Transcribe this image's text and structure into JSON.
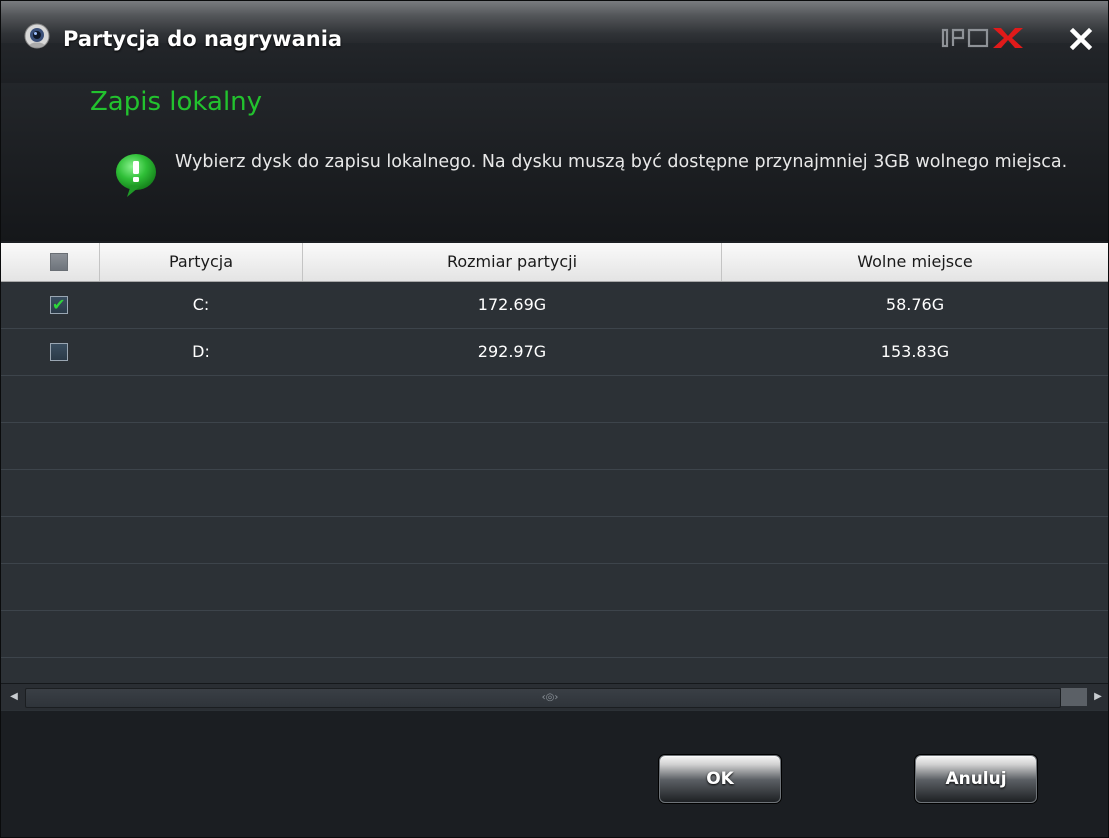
{
  "window": {
    "title": "Partycja do nagrywania",
    "logo_text": "IPOX",
    "close_symbol": "✕"
  },
  "section": {
    "title": "Zapis lokalny",
    "info_icon": "exclamation-bubble-icon",
    "info_text": "Wybierz dysk do zapisu lokalnego. Na dysku muszą być dostępne przynajmniej 3GB wolnego miejsca."
  },
  "table": {
    "columns": [
      "Partycja",
      "Rozmiar partycji",
      "Wolne miejsce"
    ],
    "rows": [
      {
        "partition": "C:",
        "size": "172.69G",
        "free": "58.76G",
        "checked": true
      },
      {
        "partition": "D:",
        "size": "292.97G",
        "free": "153.83G",
        "checked": false
      }
    ]
  },
  "scrollbar": {
    "left_arrow": "◀",
    "right_arrow": "▶",
    "grip": "‹◎›"
  },
  "buttons": {
    "ok": "OK",
    "cancel": "Anuluj"
  },
  "colors": {
    "accent_green": "#22c22e",
    "check_green": "#2ed63a",
    "background": "#1c1f23"
  }
}
